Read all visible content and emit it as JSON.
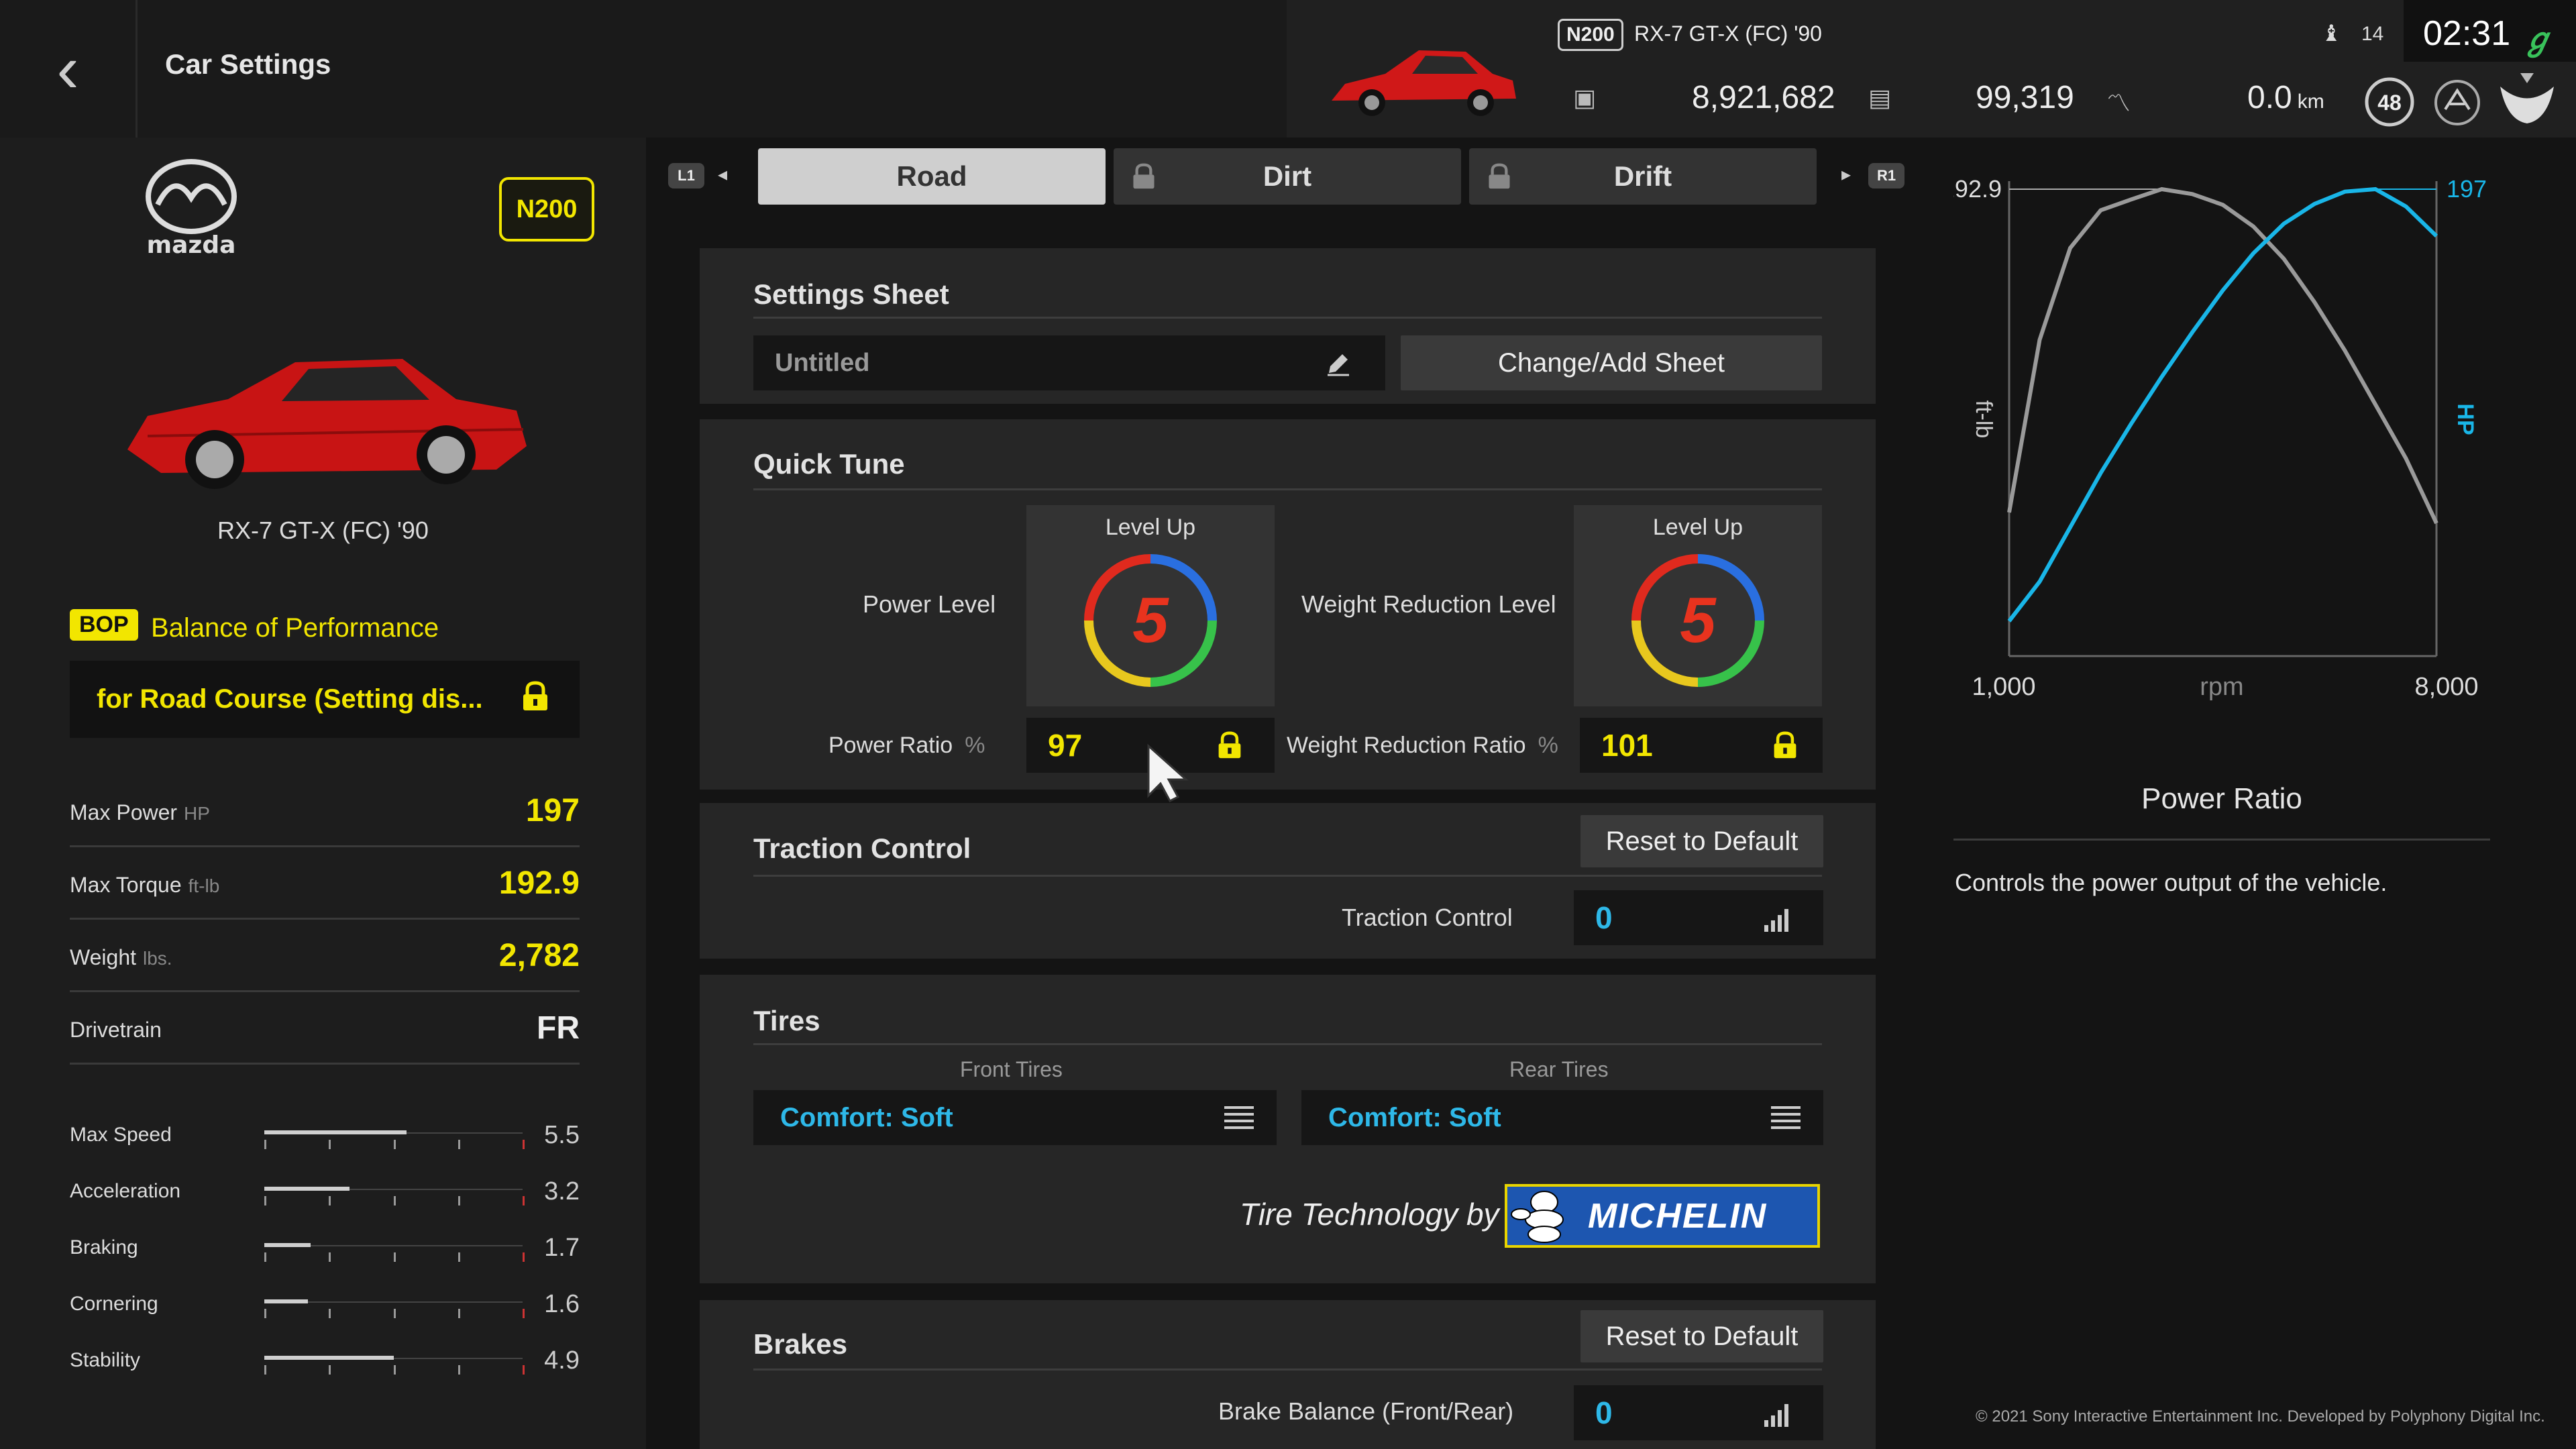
{
  "header": {
    "title": "Car Settings",
    "class_badge": "N200",
    "car_name": "RX-7 GT-X (FC) '90",
    "credits": "8,921,682",
    "mileage_points": "99,319",
    "distance": "0.0",
    "distance_unit": "km",
    "level": "48",
    "trophy_count": "14",
    "clock": "02:31"
  },
  "car": {
    "brand": "mazda",
    "class_badge": "N200",
    "name": "RX-7 GT-X (FC) '90",
    "bop_badge": "BOP",
    "bop_label": "Balance of Performance",
    "bop_setting": "for Road Course (Setting dis...",
    "stats": [
      {
        "label": "Max Power",
        "unit": "HP",
        "value": "197"
      },
      {
        "label": "Max Torque",
        "unit": "ft-lb",
        "value": "192.9"
      },
      {
        "label": "Weight",
        "unit": "lbs.",
        "value": "2,782"
      },
      {
        "label": "Drivetrain",
        "unit": "",
        "value": "FR"
      }
    ],
    "performance": [
      {
        "label": "Max Speed",
        "value": "5.5",
        "fraction": 0.55
      },
      {
        "label": "Acceleration",
        "value": "3.2",
        "fraction": 0.33
      },
      {
        "label": "Braking",
        "value": "1.7",
        "fraction": 0.18
      },
      {
        "label": "Cornering",
        "value": "1.6",
        "fraction": 0.17
      },
      {
        "label": "Stability",
        "value": "4.9",
        "fraction": 0.5
      }
    ]
  },
  "tabs": {
    "left_button": "L1",
    "right_button": "R1",
    "items": [
      {
        "label": "Road",
        "active": true,
        "locked": false
      },
      {
        "label": "Dirt",
        "active": false,
        "locked": true
      },
      {
        "label": "Drift",
        "active": false,
        "locked": true
      }
    ]
  },
  "settings_sheet": {
    "title": "Settings Sheet",
    "sheet_name": "Untitled",
    "change_button": "Change/Add Sheet"
  },
  "quick_tune": {
    "title": "Quick Tune",
    "level_up": "Level Up",
    "power_level_label": "Power Level",
    "power_level_value": "5",
    "weight_level_label": "Weight Reduction Level",
    "weight_level_value": "5",
    "power_ratio_label": "Power Ratio",
    "power_ratio_unit": "%",
    "power_ratio_value": "97",
    "weight_ratio_label": "Weight Reduction Ratio",
    "weight_ratio_unit": "%",
    "weight_ratio_value": "101"
  },
  "traction_control": {
    "title": "Traction Control",
    "reset_button": "Reset to Default",
    "label": "Traction Control",
    "value": "0"
  },
  "tires": {
    "title": "Tires",
    "front_label": "Front Tires",
    "rear_label": "Rear Tires",
    "front_value": "Comfort: Soft",
    "rear_value": "Comfort: Soft",
    "tech_label": "Tire Technology by",
    "sponsor": "MICHELIN"
  },
  "brakes": {
    "title": "Brakes",
    "reset_button": "Reset to Default",
    "label": "Brake Balance (Front/Rear)",
    "value": "0"
  },
  "colors": {
    "accent_yellow": "#f2e600",
    "accent_blue": "#2eb8e8",
    "torque_line": "#9a9a9a",
    "power_line": "#19b6e8",
    "dial_number": "#e8331e"
  },
  "chart_data": {
    "type": "line",
    "title": "",
    "xlabel": "rpm",
    "ylabel_left": "ft-lb",
    "ylabel_right": "HP",
    "x_tick_labels": [
      "1,000",
      "8,000"
    ],
    "xlim": [
      1000,
      8000
    ],
    "grid": false,
    "series": [
      {
        "name": "ft-lb",
        "color": "#9a9a9a",
        "peak_label": "192.9",
        "x": [
          1000,
          1500,
          2000,
          2500,
          3000,
          3500,
          4000,
          4500,
          5000,
          5500,
          6000,
          6500,
          7000,
          7500,
          8000
        ],
        "y": [
          133,
          165,
          182,
          189,
          191,
          192.9,
          192,
          190,
          186,
          180,
          172,
          163,
          153,
          143,
          131
        ]
      },
      {
        "name": "HP",
        "color": "#19b6e8",
        "peak_label": "197",
        "x": [
          1000,
          1500,
          2000,
          2500,
          3000,
          3500,
          4000,
          4500,
          5000,
          5500,
          6000,
          6500,
          7000,
          7500,
          8000
        ],
        "y": [
          22,
          38,
          60,
          82,
          102,
          121,
          139,
          156,
          171,
          183,
          191,
          196,
          197,
          190,
          178
        ]
      }
    ],
    "description_title": "Power Ratio",
    "description": "Controls the power output of the vehicle."
  },
  "footer": {
    "copyright": "© 2021 Sony Interactive Entertainment Inc. Developed by Polyphony Digital Inc."
  }
}
